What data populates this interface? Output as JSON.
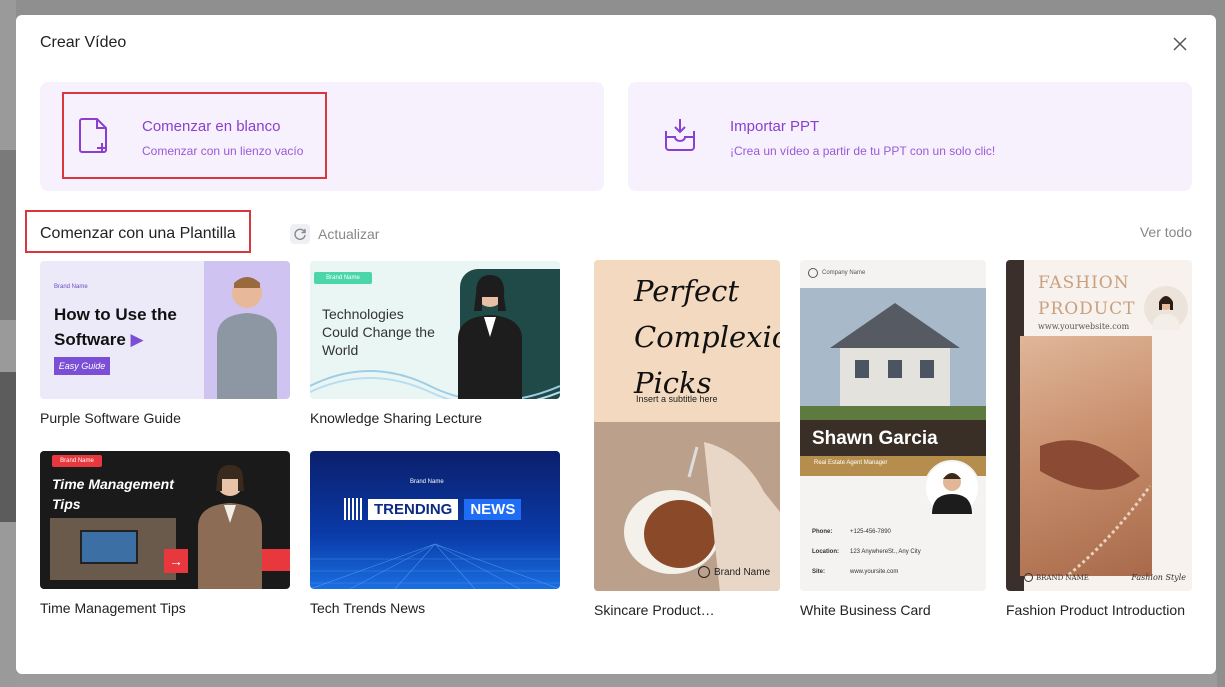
{
  "modal": {
    "title": "Crear Vídeo"
  },
  "actions": {
    "blank": {
      "title": "Comenzar en blanco",
      "subtitle": "Comenzar con un lienzo vacío"
    },
    "ppt": {
      "title": "Importar PPT",
      "subtitle": "¡Crea un vídeo a partir de tu PPT con un solo clic!"
    }
  },
  "templates_section": {
    "title": "Comenzar con una Plantilla",
    "refresh_label": "Actualizar",
    "view_all_label": "Ver todo"
  },
  "templates": [
    {
      "name": "Purple Software Guide",
      "brand": "Brand Name",
      "heading_line1": "How to Use the",
      "heading_line2": "Software",
      "tag": "Easy Guide"
    },
    {
      "name": "Knowledge Sharing Lecture",
      "brand": "Brand Name",
      "heading_line1": "Technologies",
      "heading_line2": "Could Change the",
      "heading_line3": "World"
    },
    {
      "name": "Time Management Tips",
      "brand": "Brand Name",
      "heading_line1": "Time Management",
      "heading_line2": "Tips"
    },
    {
      "name": "Tech Trends News",
      "brand": "Brand Name",
      "word1": "TRENDING",
      "word2": "NEWS"
    },
    {
      "name": "Skincare Product…",
      "heading_line1": "Perfect",
      "heading_line2": "Complexion",
      "heading_line3": "Picks",
      "subtitle": "Insert a subtitle here",
      "brand": "Brand Name"
    },
    {
      "name": "White Business Card",
      "company": "Company Name",
      "person": "Shawn Garcia",
      "role": "Real Estate Agent Manager",
      "phone_label": "Phone:",
      "phone": "+125-456-7890",
      "location_label": "Location:",
      "location": "123 AnywhereSt., Any City",
      "site_label": "Site:",
      "site": "www.yoursite.com"
    },
    {
      "name": "Fashion Product Introduction",
      "heading_line1": "FASHION",
      "heading_line2": "PRODUCT",
      "website": "www.yourwebsite.com",
      "brand": "BRAND NAME",
      "style": "Fashion Style"
    }
  ],
  "colors": {
    "accent": "#8a3fd1",
    "highlight": "#d9363e",
    "card_bg": "#f6f1fd"
  }
}
